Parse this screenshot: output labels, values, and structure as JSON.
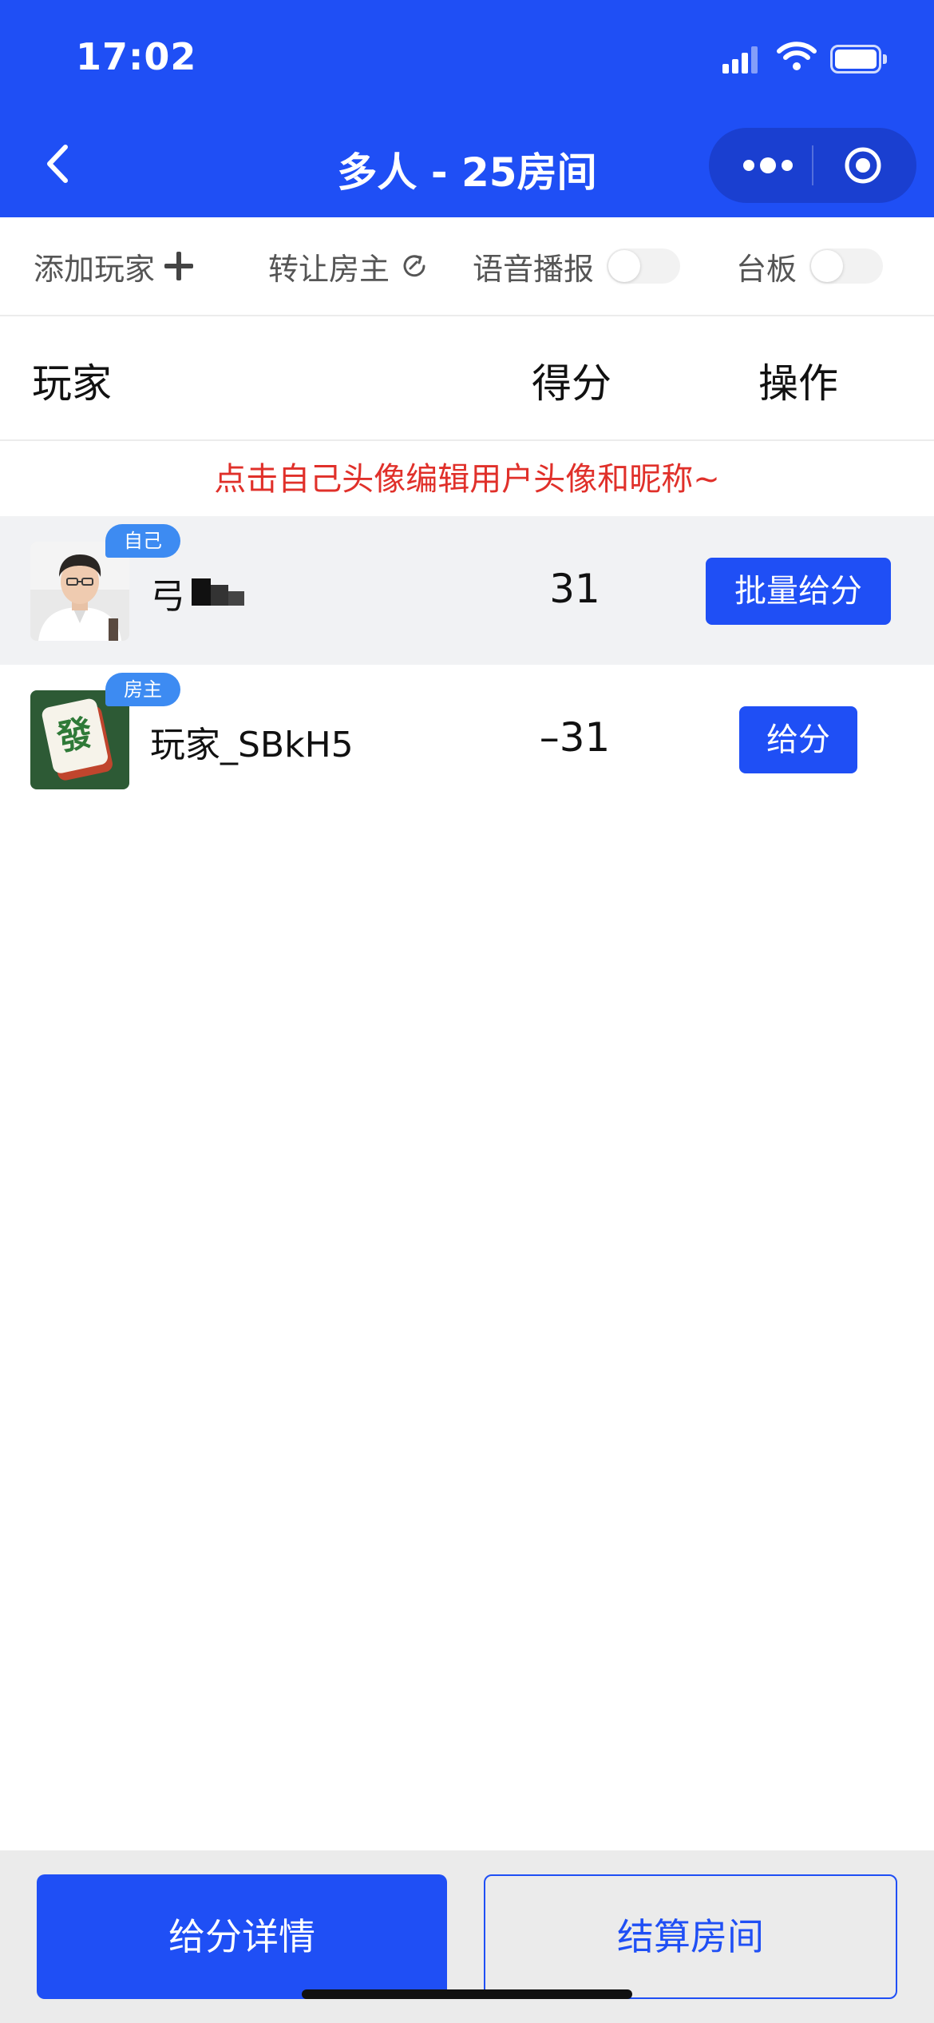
{
  "status_bar": {
    "time": "17:02"
  },
  "header": {
    "title": "多人 - 25房间"
  },
  "toolbar": {
    "add_player": "添加玩家",
    "transfer_owner": "转让房主",
    "voice_broadcast": "语音播报",
    "voice_broadcast_on": false,
    "table_board": "台板",
    "table_board_on": false
  },
  "table": {
    "col_player": "玩家",
    "col_score": "得分",
    "col_action": "操作"
  },
  "hint": "点击自己头像编辑用户头像和昵称~",
  "players": [
    {
      "tag": "自己",
      "name": "弓",
      "score": "31",
      "action": "批量给分"
    },
    {
      "tag": "房主",
      "name": "玩家_SBkH5",
      "score": "–31",
      "action": "给分"
    }
  ],
  "bottom": {
    "details": "给分详情",
    "settle": "结算房间"
  },
  "colors": {
    "primary": "#1f4ff5",
    "hint": "#e0302a",
    "tag": "#3d8bf2"
  }
}
